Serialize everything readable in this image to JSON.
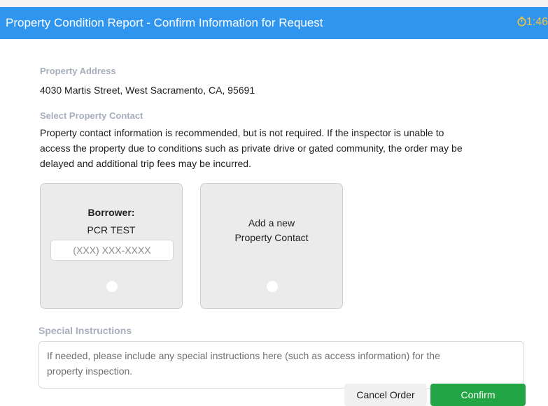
{
  "header": {
    "title": "Property Condition Report - Confirm Information for Request",
    "timer": "1:46",
    "timer_icon": "stopwatch-icon"
  },
  "property_address": {
    "label": "Property Address",
    "value": "4030 Martis Street, West Sacramento, CA, 95691"
  },
  "property_contact": {
    "label": "Select Property Contact",
    "note_lines": [
      "Property contact information is recommended, but is not required. If the inspector is unable to",
      "access the property due to conditions such as private drive or gated community, the order may be",
      "delayed and additional trip fees may be incurred."
    ]
  },
  "cards": {
    "borrower": {
      "title": "Borrower:",
      "name": "PCR TEST",
      "phone_placeholder": "(XXX) XXX-XXXX",
      "phone_value": ""
    },
    "new_contact": {
      "line1": "Add a new",
      "line2": "Property Contact"
    }
  },
  "special_instructions": {
    "label": "Special Instructions",
    "placeholder_lines": [
      "If needed, please include any special instructions here (such as access information)  for the",
      "property inspection."
    ]
  },
  "buttons": {
    "cancel": "Cancel Order",
    "confirm": "Confirm"
  },
  "colors": {
    "header_bg": "#2f95ef",
    "timer": "#f5c242",
    "confirm_bg": "#23a545"
  }
}
